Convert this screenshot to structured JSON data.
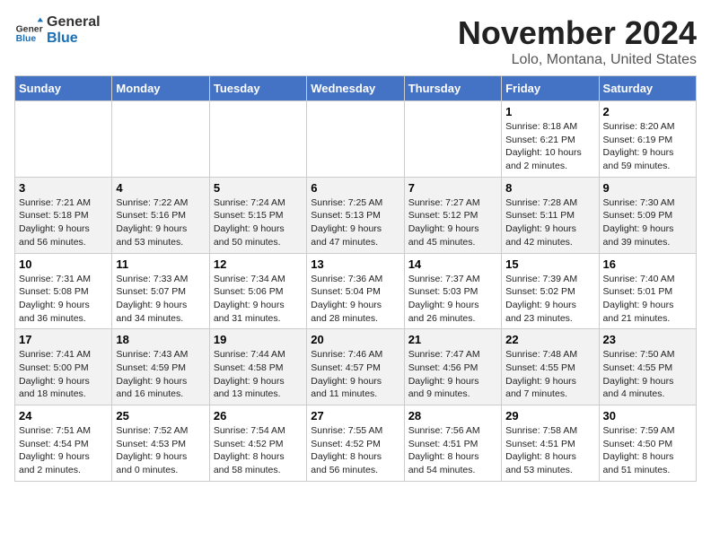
{
  "header": {
    "logo_general": "General",
    "logo_blue": "Blue",
    "month_title": "November 2024",
    "location": "Lolo, Montana, United States"
  },
  "weekdays": [
    "Sunday",
    "Monday",
    "Tuesday",
    "Wednesday",
    "Thursday",
    "Friday",
    "Saturday"
  ],
  "weeks": [
    [
      {
        "day": "",
        "info": ""
      },
      {
        "day": "",
        "info": ""
      },
      {
        "day": "",
        "info": ""
      },
      {
        "day": "",
        "info": ""
      },
      {
        "day": "",
        "info": ""
      },
      {
        "day": "1",
        "info": "Sunrise: 8:18 AM\nSunset: 6:21 PM\nDaylight: 10 hours\nand 2 minutes."
      },
      {
        "day": "2",
        "info": "Sunrise: 8:20 AM\nSunset: 6:19 PM\nDaylight: 9 hours\nand 59 minutes."
      }
    ],
    [
      {
        "day": "3",
        "info": "Sunrise: 7:21 AM\nSunset: 5:18 PM\nDaylight: 9 hours\nand 56 minutes."
      },
      {
        "day": "4",
        "info": "Sunrise: 7:22 AM\nSunset: 5:16 PM\nDaylight: 9 hours\nand 53 minutes."
      },
      {
        "day": "5",
        "info": "Sunrise: 7:24 AM\nSunset: 5:15 PM\nDaylight: 9 hours\nand 50 minutes."
      },
      {
        "day": "6",
        "info": "Sunrise: 7:25 AM\nSunset: 5:13 PM\nDaylight: 9 hours\nand 47 minutes."
      },
      {
        "day": "7",
        "info": "Sunrise: 7:27 AM\nSunset: 5:12 PM\nDaylight: 9 hours\nand 45 minutes."
      },
      {
        "day": "8",
        "info": "Sunrise: 7:28 AM\nSunset: 5:11 PM\nDaylight: 9 hours\nand 42 minutes."
      },
      {
        "day": "9",
        "info": "Sunrise: 7:30 AM\nSunset: 5:09 PM\nDaylight: 9 hours\nand 39 minutes."
      }
    ],
    [
      {
        "day": "10",
        "info": "Sunrise: 7:31 AM\nSunset: 5:08 PM\nDaylight: 9 hours\nand 36 minutes."
      },
      {
        "day": "11",
        "info": "Sunrise: 7:33 AM\nSunset: 5:07 PM\nDaylight: 9 hours\nand 34 minutes."
      },
      {
        "day": "12",
        "info": "Sunrise: 7:34 AM\nSunset: 5:06 PM\nDaylight: 9 hours\nand 31 minutes."
      },
      {
        "day": "13",
        "info": "Sunrise: 7:36 AM\nSunset: 5:04 PM\nDaylight: 9 hours\nand 28 minutes."
      },
      {
        "day": "14",
        "info": "Sunrise: 7:37 AM\nSunset: 5:03 PM\nDaylight: 9 hours\nand 26 minutes."
      },
      {
        "day": "15",
        "info": "Sunrise: 7:39 AM\nSunset: 5:02 PM\nDaylight: 9 hours\nand 23 minutes."
      },
      {
        "day": "16",
        "info": "Sunrise: 7:40 AM\nSunset: 5:01 PM\nDaylight: 9 hours\nand 21 minutes."
      }
    ],
    [
      {
        "day": "17",
        "info": "Sunrise: 7:41 AM\nSunset: 5:00 PM\nDaylight: 9 hours\nand 18 minutes."
      },
      {
        "day": "18",
        "info": "Sunrise: 7:43 AM\nSunset: 4:59 PM\nDaylight: 9 hours\nand 16 minutes."
      },
      {
        "day": "19",
        "info": "Sunrise: 7:44 AM\nSunset: 4:58 PM\nDaylight: 9 hours\nand 13 minutes."
      },
      {
        "day": "20",
        "info": "Sunrise: 7:46 AM\nSunset: 4:57 PM\nDaylight: 9 hours\nand 11 minutes."
      },
      {
        "day": "21",
        "info": "Sunrise: 7:47 AM\nSunset: 4:56 PM\nDaylight: 9 hours\nand 9 minutes."
      },
      {
        "day": "22",
        "info": "Sunrise: 7:48 AM\nSunset: 4:55 PM\nDaylight: 9 hours\nand 7 minutes."
      },
      {
        "day": "23",
        "info": "Sunrise: 7:50 AM\nSunset: 4:55 PM\nDaylight: 9 hours\nand 4 minutes."
      }
    ],
    [
      {
        "day": "24",
        "info": "Sunrise: 7:51 AM\nSunset: 4:54 PM\nDaylight: 9 hours\nand 2 minutes."
      },
      {
        "day": "25",
        "info": "Sunrise: 7:52 AM\nSunset: 4:53 PM\nDaylight: 9 hours\nand 0 minutes."
      },
      {
        "day": "26",
        "info": "Sunrise: 7:54 AM\nSunset: 4:52 PM\nDaylight: 8 hours\nand 58 minutes."
      },
      {
        "day": "27",
        "info": "Sunrise: 7:55 AM\nSunset: 4:52 PM\nDaylight: 8 hours\nand 56 minutes."
      },
      {
        "day": "28",
        "info": "Sunrise: 7:56 AM\nSunset: 4:51 PM\nDaylight: 8 hours\nand 54 minutes."
      },
      {
        "day": "29",
        "info": "Sunrise: 7:58 AM\nSunset: 4:51 PM\nDaylight: 8 hours\nand 53 minutes."
      },
      {
        "day": "30",
        "info": "Sunrise: 7:59 AM\nSunset: 4:50 PM\nDaylight: 8 hours\nand 51 minutes."
      }
    ]
  ]
}
